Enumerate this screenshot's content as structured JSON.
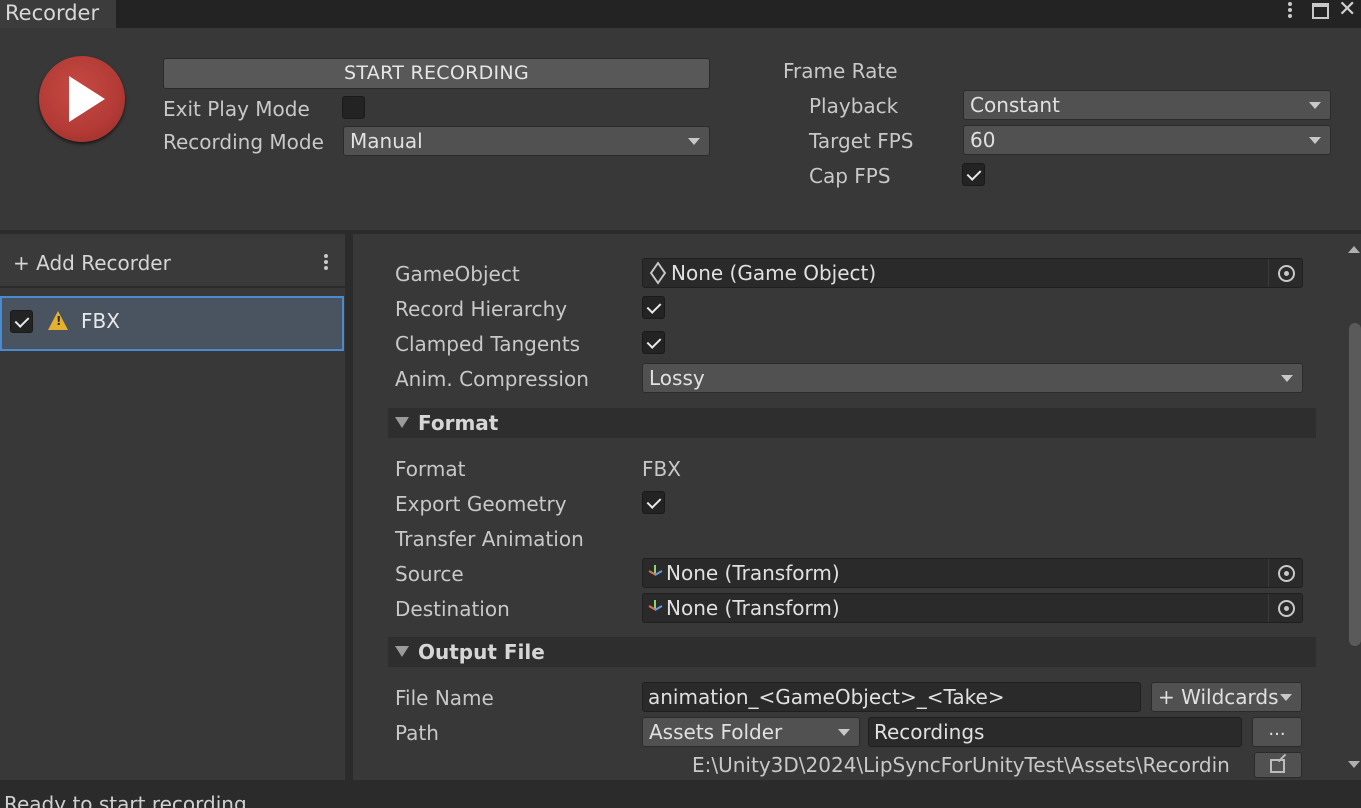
{
  "window": {
    "title": "Recorder"
  },
  "top": {
    "start_label": "START RECORDING",
    "exit_play_mode_label": "Exit Play Mode",
    "exit_play_mode_checked": false,
    "recording_mode_label": "Recording Mode",
    "recording_mode_value": "Manual",
    "frame_rate_label": "Frame Rate",
    "playback_label": "Playback",
    "playback_value": "Constant",
    "target_fps_label": "Target FPS",
    "target_fps_value": "60",
    "cap_fps_label": "Cap FPS",
    "cap_fps_checked": true
  },
  "recorders": {
    "add_label": "+ Add Recorder",
    "items": [
      {
        "label": "FBX",
        "enabled": true,
        "warning": true
      }
    ]
  },
  "settings": {
    "gameobject_label": "GameObject",
    "gameobject_value": "None (Game Object)",
    "record_hierarchy_label": "Record Hierarchy",
    "record_hierarchy_checked": true,
    "clamped_tangents_label": "Clamped Tangents",
    "clamped_tangents_checked": true,
    "anim_compression_label": "Anim. Compression",
    "anim_compression_value": "Lossy",
    "format_section": "Format",
    "format_label": "Format",
    "format_value": "FBX",
    "export_geometry_label": "Export Geometry",
    "export_geometry_checked": true,
    "transfer_animation_label": "Transfer Animation",
    "source_label": "Source",
    "source_value": "None (Transform)",
    "destination_label": "Destination",
    "destination_value": "None (Transform)",
    "output_section": "Output File",
    "file_name_label": "File Name",
    "file_name_value": "animation_<GameObject>_<Take>",
    "wildcards_label": "+ Wildcards",
    "path_label": "Path",
    "path_root_value": "Assets Folder",
    "path_value": "Recordings",
    "browse_label": "...",
    "full_path": "E:\\Unity3D\\2024\\LipSyncForUnityTest\\Assets\\Recordin"
  },
  "status": {
    "text": "Ready to start recording"
  },
  "colors": {
    "accent_record": "#b33a35",
    "selection_border": "#4a8ad0",
    "warning": "#e6b12e"
  }
}
